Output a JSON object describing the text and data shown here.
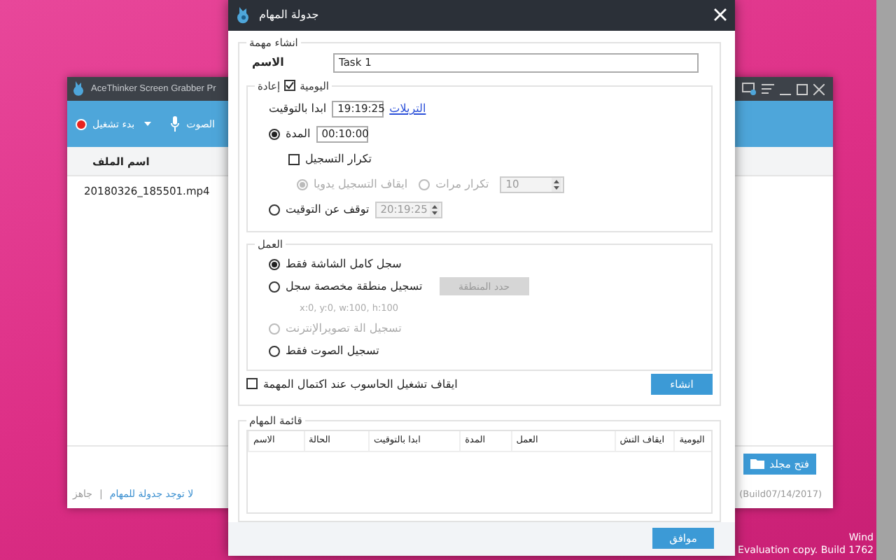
{
  "desktop": {
    "notice_lines": [
      "Wind",
      "Evaluation copy. Build 1762"
    ]
  },
  "background_window": {
    "title": "AceThinker Screen Grabber Pr",
    "record_button": "بدء تشغيل",
    "audio_label": "الصوت",
    "file_column": "اسم الملف",
    "files": [
      "20180326_185501.mp4"
    ],
    "open_folder_button": "فتح مجلد",
    "status": "جاهز",
    "separator": "|",
    "schedule_status": "لا توجد جدولة للمهام",
    "build_text": "(Build07/14/2017)"
  },
  "dialog": {
    "title": "جدولة المهام",
    "create_group": {
      "legend": "انشاء مهمة",
      "name_label": "الاسم",
      "name_value": "Task 1"
    },
    "repeat_group": {
      "daily_label": "اليومية",
      "daily_checked": true,
      "repeat_label": "إعادة",
      "start_label": "ابدا بالتوقيت",
      "start_value": "19:19:25",
      "triggers_link": "التريلات",
      "duration": {
        "label": "المدة",
        "value": "00:10:00",
        "selected": true
      },
      "repeat_recording": {
        "label": "تكرار التسجيل",
        "checked": false
      },
      "stop_manually": {
        "label": "ايقاف التسجيل يدويا",
        "selected": true,
        "disabled": true
      },
      "repeat_times": {
        "label": "تكرار مرات",
        "selected": false,
        "disabled": true,
        "value": "10"
      },
      "stop_at": {
        "label": "توقف عن التوقيت",
        "selected": false,
        "value": "20:19:25",
        "disabled": true
      }
    },
    "action_group": {
      "legend": "العمل",
      "options": [
        {
          "kind": "plain",
          "label": "سجل كامل الشاشة فقط",
          "selected": true,
          "disabled": false
        },
        {
          "kind": "region",
          "label": "تسجيل منطقة مخصصة سجل",
          "selected": false,
          "disabled": false,
          "button": "حدد المنطقة",
          "coords": "x:0, y:0, w:100, h:100"
        },
        {
          "kind": "plain",
          "label": "تسجيل الة تصويرالإنترنت",
          "selected": false,
          "disabled": true
        },
        {
          "kind": "plain",
          "label": "تسجيل الصوت فقط",
          "selected": false,
          "disabled": false
        }
      ]
    },
    "shutdown": {
      "label": "ايقاف تشغيل الحاسوب عند اكتمال المهمة",
      "checked": false
    },
    "create_button": "انشاء",
    "task_list": {
      "legend": "قائمة المهام",
      "columns": [
        "اليومية",
        "ايقاف التش",
        "العمل",
        "المدة",
        "ابدا بالتوقيت",
        "الحالة",
        "الاسم"
      ]
    },
    "ok_button": "موافق"
  }
}
